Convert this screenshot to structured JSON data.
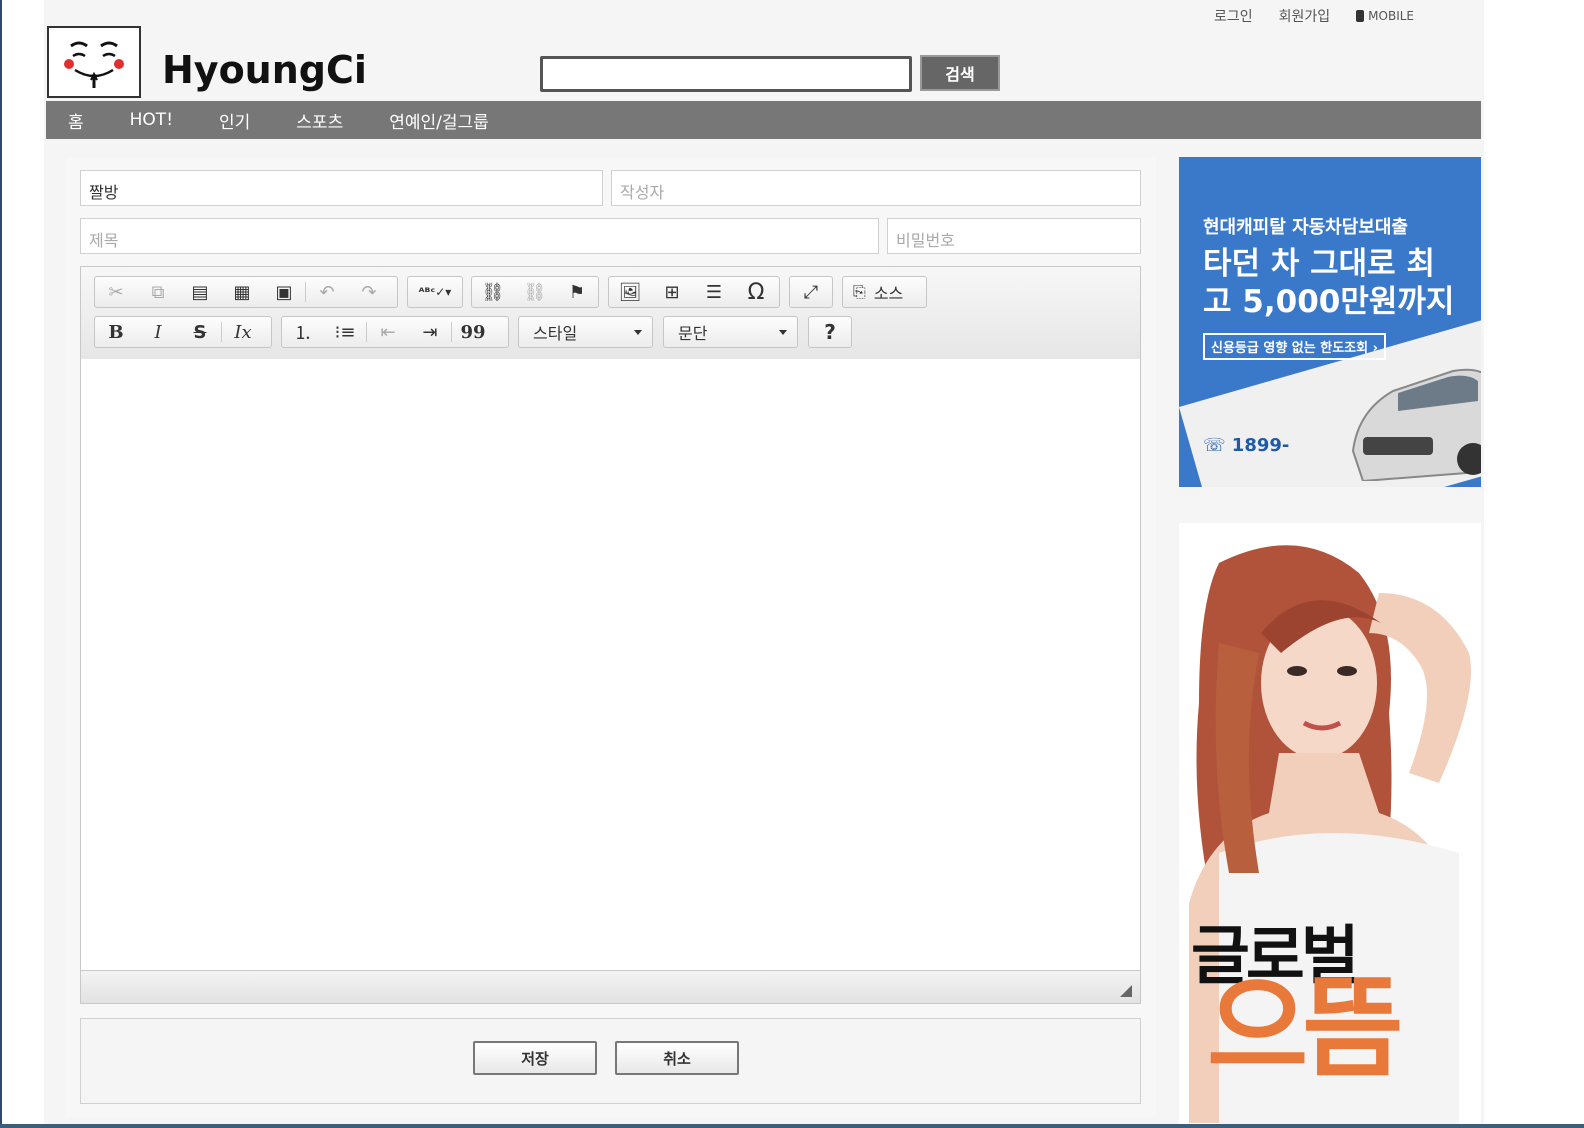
{
  "top_links": {
    "login": "로그인",
    "signup": "회원가입",
    "mobile": "MOBILE"
  },
  "header": {
    "logo_text": "HyoungCi",
    "search_placeholder": "",
    "search_button": "검색"
  },
  "nav": {
    "items": [
      "홈",
      "HOT!",
      "인기",
      "스포츠",
      "연예인/걸그룹"
    ]
  },
  "form": {
    "category_value": "짤방",
    "author_placeholder": "작성자",
    "title_placeholder": "제목",
    "password_placeholder": "비밀번호"
  },
  "editor": {
    "toolbar_row1": [
      "cut-icon",
      "copy-icon",
      "paste-icon",
      "paste-text-icon",
      "paste-word-icon",
      "undo-icon",
      "redo-icon",
      "spellcheck-icon",
      "link-icon",
      "unlink-icon",
      "anchor-icon",
      "image-icon",
      "table-icon",
      "horizontal-rule-icon",
      "special-char-icon",
      "maximize-icon",
      "source-icon"
    ],
    "source_label": "소스",
    "style_combo": "스타일",
    "format_combo": "문단",
    "help": "?",
    "omega": "Ω",
    "bold": "B",
    "italic": "I",
    "strike": "S",
    "remove_format": "Ix",
    "quote": "99"
  },
  "actions": {
    "save": "저장",
    "cancel": "취소"
  },
  "ad1": {
    "line1": "현대캐피탈 자동차담보대출",
    "line2": "타던 차 그대로 최고 5,000만원까지",
    "line3": "신용등급 영향 없는 한도조회 ›",
    "phone": "1899-",
    "bg_color": "#3a78c9"
  },
  "ad2": {
    "line1": "글로벌",
    "line2": "으뜸"
  }
}
